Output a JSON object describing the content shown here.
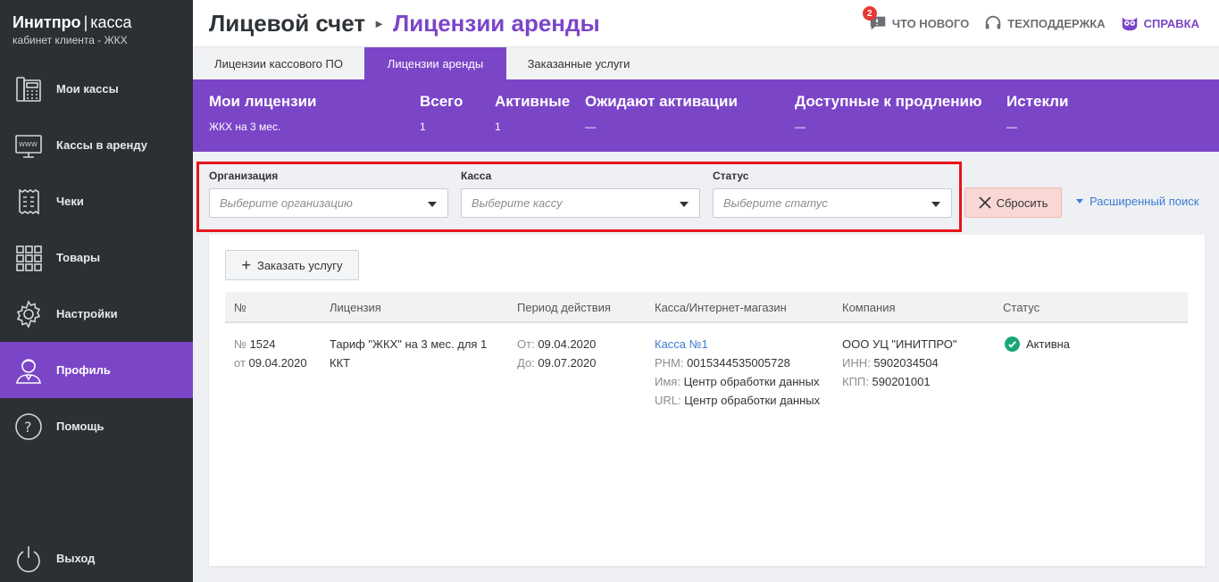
{
  "brand": {
    "name": "Инитпро",
    "divider": "|",
    "product": "касса",
    "subtitle": "кабинет клиента - ЖКХ"
  },
  "sidebar": {
    "items": [
      {
        "label": "Мои кассы",
        "icon": "cash-register-icon"
      },
      {
        "label": "Кассы в аренду",
        "icon": "monitor-www-icon"
      },
      {
        "label": "Чеки",
        "icon": "receipt-icon"
      },
      {
        "label": "Товары",
        "icon": "grid-icon"
      },
      {
        "label": "Настройки",
        "icon": "gear-icon"
      },
      {
        "label": "Профиль",
        "icon": "user-icon",
        "active": true
      },
      {
        "label": "Помощь",
        "icon": "question-icon"
      },
      {
        "label": "Выход",
        "icon": "power-icon"
      }
    ]
  },
  "header": {
    "breadcrumb_root": "Лицевой счет",
    "breadcrumb_current": "Лицензии аренды",
    "whats_new": "ЧТО НОВОГО",
    "whats_new_badge": "2",
    "support": "ТЕХПОДДЕРЖКА",
    "help": "СПРАВКА"
  },
  "tabs": [
    {
      "label": "Лицензии кассового ПО"
    },
    {
      "label": "Лицензии аренды",
      "active": true
    },
    {
      "label": "Заказанные услуги"
    }
  ],
  "summary": {
    "my_licenses": {
      "label": "Мои лицензии",
      "value": "ЖКХ на 3 мес."
    },
    "total": {
      "label": "Всего",
      "value": "1"
    },
    "active": {
      "label": "Активные",
      "value": "1"
    },
    "pending": {
      "label": "Ожидают активации",
      "value": "—"
    },
    "renewable": {
      "label": "Доступные к продлению",
      "value": "—"
    },
    "expired": {
      "label": "Истекли",
      "value": "—"
    }
  },
  "filters": {
    "organization": {
      "label": "Организация",
      "placeholder": "Выберите организацию"
    },
    "register": {
      "label": "Касса",
      "placeholder": "Выберите кассу"
    },
    "status": {
      "label": "Статус",
      "placeholder": "Выберите статус"
    },
    "reset_label": "Сбросить",
    "advanced_label": "Расширенный поиск"
  },
  "table": {
    "order_button": "Заказать услугу",
    "columns": [
      "№",
      "Лицензия",
      "Период действия",
      "Касса/Интернет-магазин",
      "Компания",
      "Статус"
    ],
    "rows": [
      {
        "number_prefix": "№",
        "number": "1524",
        "date_prefix": "от",
        "date": "09.04.2020",
        "license": "Тариф \"ЖКХ\" на 3 мес. для 1 ККТ",
        "from_label": "От:",
        "from": "09.04.2020",
        "to_label": "До:",
        "to": "09.07.2020",
        "register_link": "Касса №1",
        "rnm_label": "РНМ:",
        "rnm": "0015344535005728",
        "name_label": "Имя:",
        "name": "Центр обработки данных",
        "url_label": "URL:",
        "url": "Центр обработки данных",
        "company": "ООО УЦ \"ИНИТПРО\"",
        "inn_label": "ИНН:",
        "inn": "5902034504",
        "kpp_label": "КПП:",
        "kpp": "590201001",
        "status": "Активна"
      }
    ]
  },
  "colors": {
    "accent": "#7b45c8",
    "sidebar": "#2c2f34",
    "highlight": "#e8131b",
    "success": "#1aa67a",
    "link": "#3b7bd6"
  }
}
